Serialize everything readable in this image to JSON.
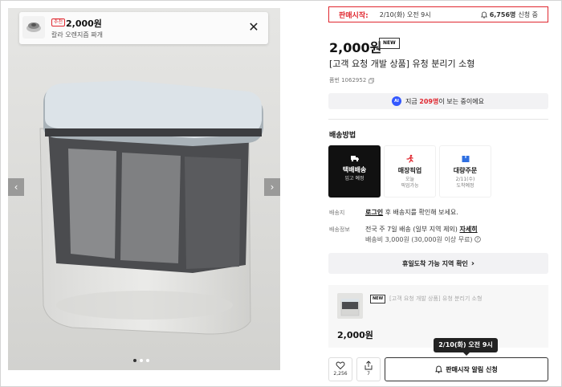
{
  "toast": {
    "badge": "추천",
    "price": "2,000원",
    "name": "칼라 오렌지즙 짜개"
  },
  "gallery": {
    "dots_count": 3,
    "active_dot": 0
  },
  "sale": {
    "label": "판매시작:",
    "date": "2/10(화) 오전 9시",
    "count": "6,756명",
    "count_suffix": "신청 중"
  },
  "product": {
    "price": "2,000원",
    "badge": "NEW",
    "title": "[고객 요청 개발 상품] 유청 분리기 소형",
    "number": "품번 1062952"
  },
  "viewers": {
    "ai_label": "AI",
    "prefix": "지금",
    "count": "209명",
    "suffix": "이 보는 중이에요"
  },
  "shipping": {
    "heading": "배송방법",
    "options": [
      {
        "label": "택배배송",
        "sub": "입고 예정",
        "sub2": "",
        "selected": true
      },
      {
        "label": "매장픽업",
        "sub": "오늘",
        "sub2": "픽업가능",
        "selected": false
      },
      {
        "label": "대량주문",
        "sub": "2/11(수)",
        "sub2": "도착예정",
        "selected": false
      }
    ]
  },
  "info": {
    "dest_label": "배송지",
    "dest_link": "로그인",
    "dest_text": "후 배송지를 확인해 보세요.",
    "ship_label": "배송정보",
    "ship_text": "전국 주 7일 배송 (일부 지역 제외)",
    "ship_detail": "자세히",
    "fee_text": "배송비 3,000원 (30,000원 이상 무료)"
  },
  "arrival": {
    "label": "휴일도착 가능 지역 확인"
  },
  "mini": {
    "badge": "NEW",
    "title": "[고객 요청 개발 상품] 유청 분리기 소형",
    "price": "2,000원"
  },
  "actions": {
    "like_count": "2,256",
    "share_count": "7",
    "notify_label": "판매시작 알림 신청",
    "tooltip": "2/10(화) 오전 9시"
  },
  "colors": {
    "accent": "#e0272f",
    "ai": "#3358ff",
    "dark": "#111111"
  }
}
